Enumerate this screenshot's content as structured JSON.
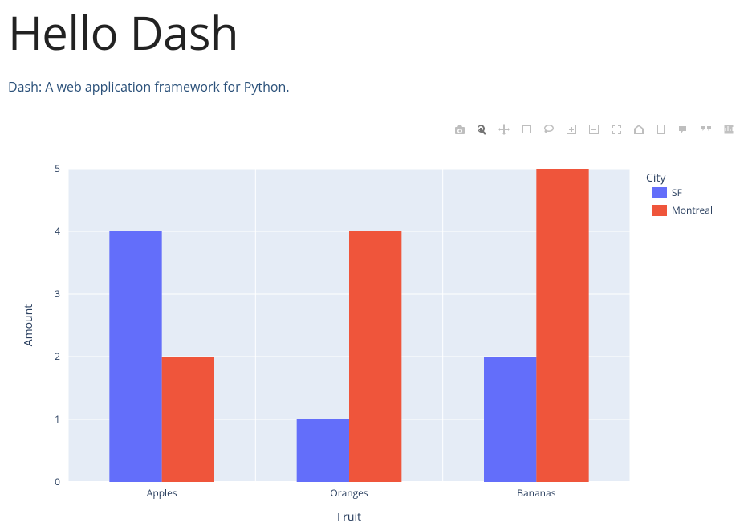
{
  "header": {
    "title": "Hello Dash",
    "subtitle": "Dash: A web application framework for Python."
  },
  "modebar": {
    "buttons": [
      {
        "name": "camera-icon",
        "label": "Download plot as a png"
      },
      {
        "name": "zoom-icon",
        "label": "Zoom",
        "active": true
      },
      {
        "name": "pan-icon",
        "label": "Pan"
      },
      {
        "name": "select-icon",
        "label": "Box Select"
      },
      {
        "name": "lasso-icon",
        "label": "Lasso Select"
      },
      {
        "name": "zoom-in-icon",
        "label": "Zoom in"
      },
      {
        "name": "zoom-out-icon",
        "label": "Zoom out"
      },
      {
        "name": "autoscale-icon",
        "label": "Autoscale"
      },
      {
        "name": "reset-axes-icon",
        "label": "Reset axes"
      },
      {
        "name": "spike-lines-icon",
        "label": "Toggle Spike Lines"
      },
      {
        "name": "closest-hover-icon",
        "label": "Show closest data on hover"
      },
      {
        "name": "compare-hover-icon",
        "label": "Compare data on hover"
      },
      {
        "name": "plotly-logo-icon",
        "label": "Produced with Plotly"
      }
    ]
  },
  "chart_data": {
    "type": "bar",
    "title": "",
    "xlabel": "Fruit",
    "ylabel": "Amount",
    "legend_title": "City",
    "categories": [
      "Apples",
      "Oranges",
      "Bananas"
    ],
    "series": [
      {
        "name": "SF",
        "color": "#636efa",
        "values": [
          4,
          1,
          2
        ]
      },
      {
        "name": "Montreal",
        "color": "#EF553B",
        "values": [
          2,
          4,
          5
        ]
      }
    ],
    "ylim": [
      0,
      5
    ],
    "yticks": [
      0,
      1,
      2,
      3,
      4,
      5
    ],
    "colors": {
      "plot_bg": "#e5ecf6",
      "grid": "#ffffff",
      "text": "#2a3f5f"
    }
  }
}
